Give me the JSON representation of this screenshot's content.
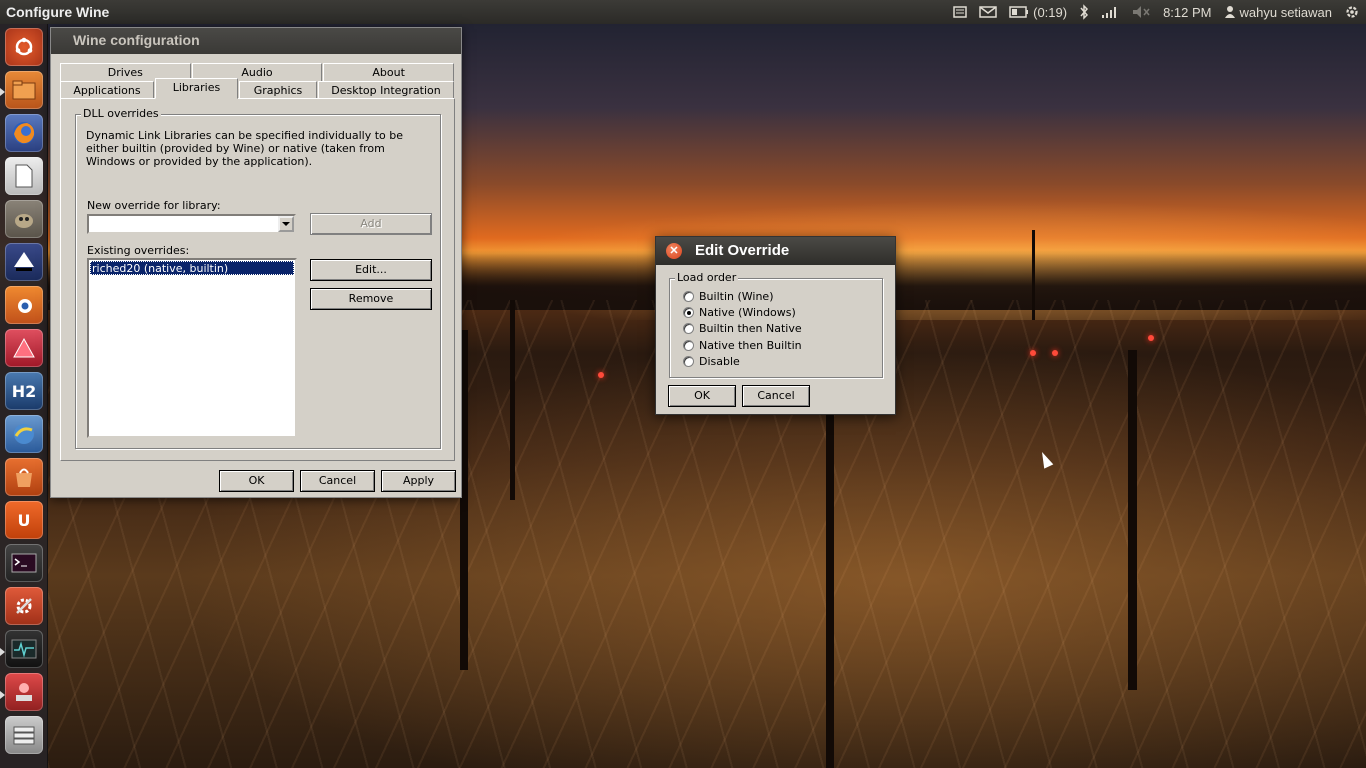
{
  "top_panel": {
    "app_title": "Configure Wine",
    "battery": "(0:19)",
    "clock": "8:12 PM",
    "user": "wahyu setiawan"
  },
  "launcher": {
    "items": [
      "ubuntu-dash-icon",
      "files-icon",
      "firefox-icon",
      "libreoffice-icon",
      "gimp-icon",
      "inkscape-icon",
      "blender-icon",
      "app-icon",
      "h2-icon",
      "browser-icon",
      "software-center-icon",
      "ubuntu-one-icon",
      "terminal-icon",
      "system-settings-icon",
      "system-monitor-icon",
      "remote-desktop-icon",
      "file-manager-icon"
    ]
  },
  "wine_window": {
    "title": "Wine configuration",
    "tabs_top": [
      "Drives",
      "Audio",
      "About"
    ],
    "tabs_bottom": [
      "Applications",
      "Libraries",
      "Graphics",
      "Desktop Integration"
    ],
    "active_tab": "Libraries",
    "group_label": "DLL overrides",
    "description": "Dynamic Link Libraries can be specified individually to be either builtin (provided by Wine) or native (taken from Windows or provided by the application).",
    "new_override_label": "New override for library:",
    "new_override_value": "",
    "add_button": "Add",
    "existing_label": "Existing overrides:",
    "existing_overrides": [
      "riched20 (native, builtin)"
    ],
    "edit_button": "Edit...",
    "remove_button": "Remove",
    "ok_button": "OK",
    "cancel_button": "Cancel",
    "apply_button": "Apply"
  },
  "edit_override_dialog": {
    "title": "Edit Override",
    "group_label": "Load order",
    "options": [
      "Builtin (Wine)",
      "Native (Windows)",
      "Builtin then Native",
      "Native then Builtin",
      "Disable"
    ],
    "selected": "Native (Windows)",
    "ok_button": "OK",
    "cancel_button": "Cancel"
  }
}
